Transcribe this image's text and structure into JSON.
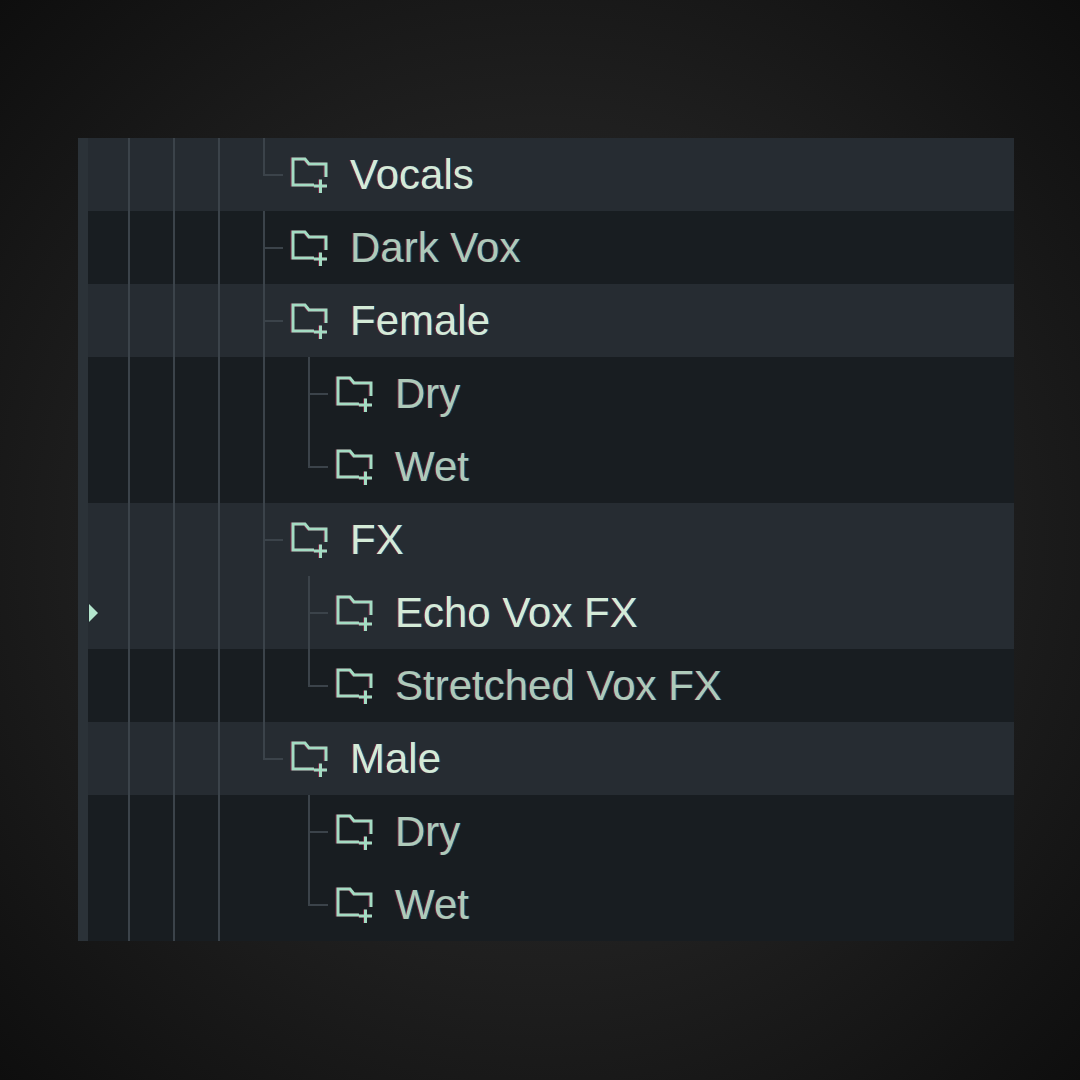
{
  "browser": {
    "tree": {
      "label": "Vocals",
      "expanded": true,
      "selected": false,
      "children": [
        {
          "label": "Dark Vox",
          "expanded": false,
          "selected": false
        },
        {
          "label": "Female",
          "expanded": true,
          "selected": false,
          "children": [
            {
              "label": "Dry",
              "expanded": false,
              "selected": false
            },
            {
              "label": "Wet",
              "expanded": false,
              "selected": false
            }
          ]
        },
        {
          "label": "FX",
          "expanded": true,
          "selected": false,
          "children": [
            {
              "label": "Echo Vox FX",
              "expanded": false,
              "selected": true
            },
            {
              "label": "Stretched Vox FX",
              "expanded": false,
              "selected": false
            }
          ]
        },
        {
          "label": "Male",
          "expanded": true,
          "selected": false,
          "children": [
            {
              "label": "Dry",
              "expanded": false,
              "selected": false
            },
            {
              "label": "Wet",
              "expanded": false,
              "selected": false
            }
          ]
        }
      ]
    }
  }
}
